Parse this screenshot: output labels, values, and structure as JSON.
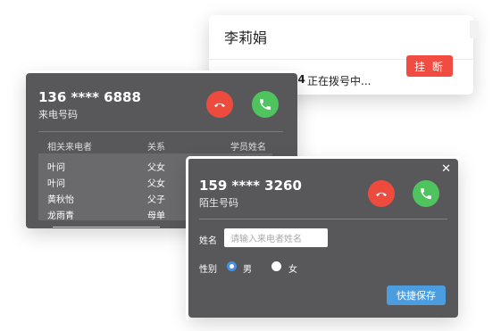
{
  "outgoing": {
    "name": "李莉娟",
    "number": "13628569964",
    "status": "正在拨号中...",
    "hangup_label": "挂 断"
  },
  "incoming": {
    "number": "136 **** 6888",
    "subtitle": "来电号码",
    "columns": [
      "相关来电者",
      "关系",
      "学员姓名"
    ],
    "rows": [
      {
        "caller": "叶问",
        "relation": "父女"
      },
      {
        "caller": "叶问",
        "relation": "父女"
      },
      {
        "caller": "黄秋怡",
        "relation": "父子"
      },
      {
        "caller": "龙雨青",
        "relation": "母单"
      }
    ]
  },
  "stranger": {
    "close_glyph": "✕",
    "number": "159 **** 3260",
    "subtitle": "陌生号码",
    "name_label": "姓名",
    "name_placeholder": "请输入来电者姓名",
    "gender_label": "性别",
    "gender_options": [
      "男",
      "女"
    ],
    "gender_selected": "男",
    "save_label": "快捷保存"
  },
  "colors": {
    "panel_bg": "#58585a",
    "hangup_red": "#ee4b3f",
    "answer_green": "#4fc35e",
    "accent_blue": "#4c9ce0"
  },
  "icons": [
    "phone-hangup-icon",
    "phone-answer-icon",
    "close-icon"
  ]
}
